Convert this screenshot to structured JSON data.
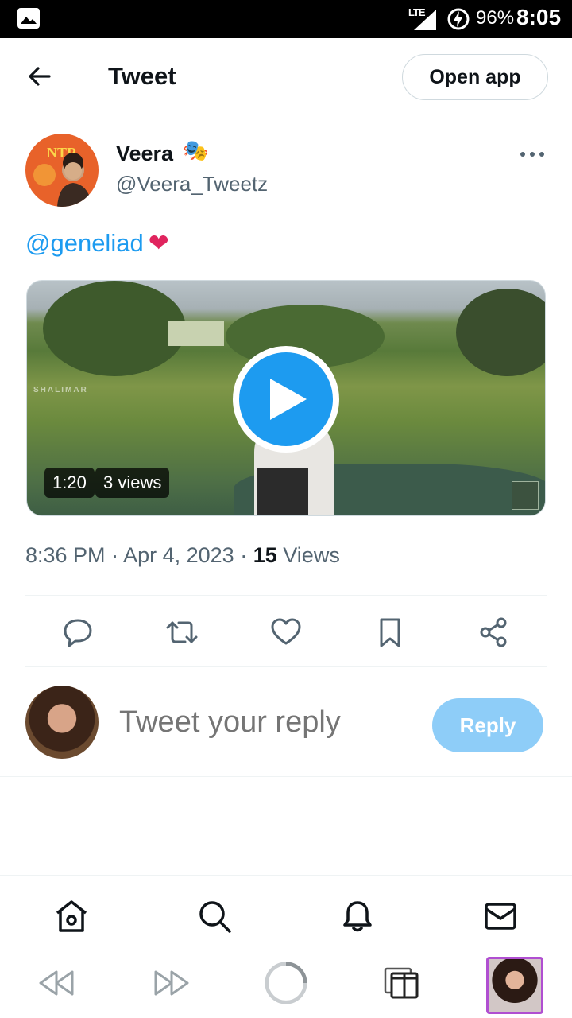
{
  "status_bar": {
    "network": "LTE",
    "battery": "96%",
    "time": "8:05"
  },
  "header": {
    "title": "Tweet",
    "open_app_label": "Open app"
  },
  "tweet": {
    "author": {
      "avatar_text": "NTR",
      "display_name": "Veera",
      "name_emoji": "🎭",
      "handle": "@Veera_Tweetz"
    },
    "text": {
      "mention": "@geneliad",
      "emoji": "❤"
    },
    "video": {
      "watermark": "SHALIMAR",
      "duration": "1:20",
      "views_label": "3 views"
    },
    "meta": {
      "time": "8:36 PM",
      "date": "Apr 4, 2023",
      "views_count": "15",
      "views_label": "Views"
    },
    "actions": [
      "reply",
      "retweet",
      "like",
      "bookmark",
      "share"
    ]
  },
  "reply_box": {
    "placeholder": "Tweet your reply",
    "button_label": "Reply"
  },
  "bottom_nav": [
    "home",
    "search",
    "notifications",
    "messages"
  ],
  "browser_bar": [
    "back",
    "forward",
    "reload",
    "tabs",
    "profile"
  ],
  "colors": {
    "accent": "#1d9bf0",
    "reply_button_disabled": "#8ecdf8",
    "text_primary": "#0f1419",
    "text_secondary": "#536471"
  }
}
